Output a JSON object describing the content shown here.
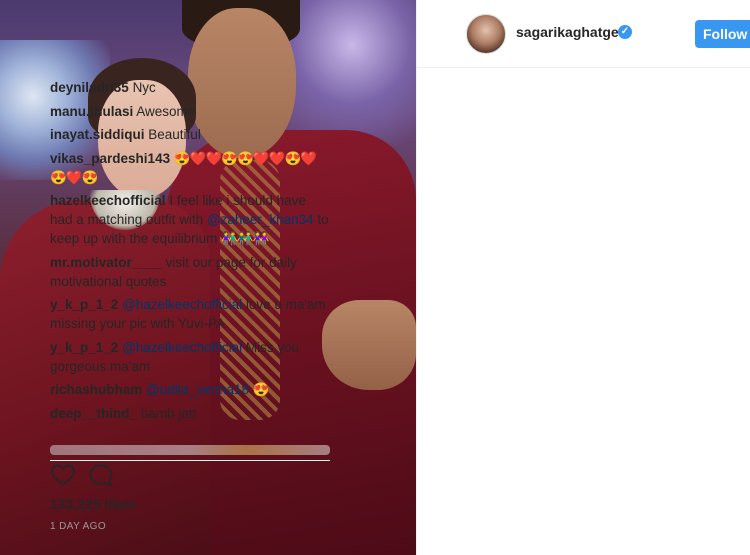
{
  "post": {
    "username": "sagarikaghatge",
    "follow_label": "Follow",
    "likes": "133,225 likes",
    "time_ago": "1 DAY AGO"
  },
  "comments": [
    {
      "user": "deyniladri35",
      "parts": [
        {
          "t": "text",
          "v": "Nyc"
        }
      ]
    },
    {
      "user": "manu.thulasi",
      "parts": [
        {
          "t": "text",
          "v": "Awesome"
        }
      ]
    },
    {
      "user": "inayat.siddiqui",
      "parts": [
        {
          "t": "text",
          "v": "Beautiful"
        }
      ]
    },
    {
      "user": "vikas_pardeshi143",
      "parts": [
        {
          "t": "emoji",
          "v": "😍❤️❤️😍😍❤️❤️😍❤️😍❤️😍"
        }
      ]
    },
    {
      "user": "hazelkeechofficial",
      "parts": [
        {
          "t": "text",
          "v": "I feel like i should have had a matching outfit with"
        },
        {
          "t": "mention",
          "v": "@zaheer_khan34"
        },
        {
          "t": "text",
          "v": "to keep up with the equilibrium"
        },
        {
          "t": "emoji",
          "v": "👫👬👭"
        }
      ]
    },
    {
      "user": "mr.motivator____",
      "parts": [
        {
          "t": "text",
          "v": "visit our page for daily motivational quotes"
        }
      ]
    },
    {
      "user": "y_k_p_1_2",
      "parts": [
        {
          "t": "mention",
          "v": "@hazelkeechofficial"
        },
        {
          "t": "text",
          "v": "love u ma'am missing your pic with Yuvi-PA"
        }
      ]
    },
    {
      "user": "y_k_p_1_2",
      "parts": [
        {
          "t": "mention",
          "v": "@hazelkeechofficial"
        },
        {
          "t": "text",
          "v": "Miss you gorgeous ma'am"
        }
      ]
    },
    {
      "user": "richashubham",
      "parts": [
        {
          "t": "mention",
          "v": "@udita_verma18"
        },
        {
          "t": "emoji",
          "v": "😍"
        }
      ]
    },
    {
      "user": "deep__thind_",
      "parts": [
        {
          "t": "text",
          "v": "bamb jatt"
        }
      ]
    }
  ],
  "icons": {
    "verified": "verified-badge-icon",
    "like": "heart-icon",
    "comment": "speech-bubble-icon"
  },
  "colors": {
    "accent": "#3897f0",
    "text": "#262626",
    "mention": "#003569",
    "muted": "#999999"
  }
}
